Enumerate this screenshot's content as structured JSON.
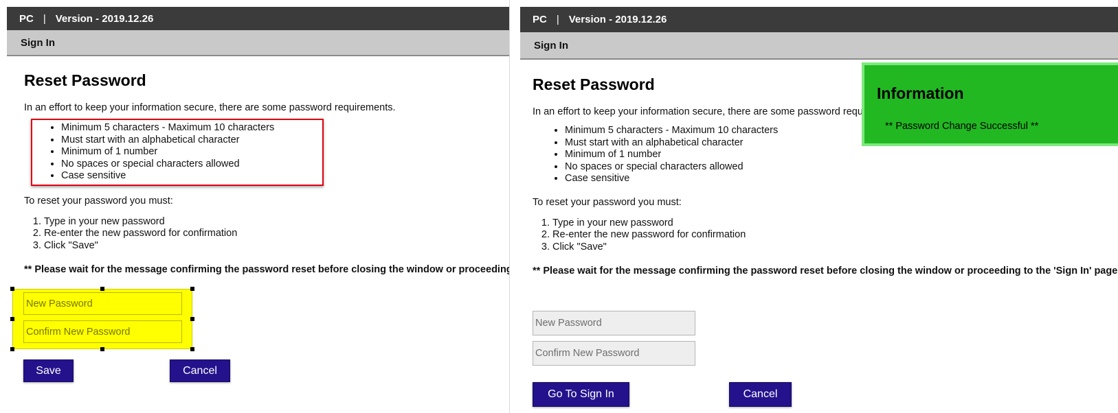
{
  "window": {
    "app": "PC",
    "separator": "|",
    "version": "Version - 2019.12.26",
    "nav": "Sign In"
  },
  "page": {
    "heading": "Reset Password",
    "intro": "In an effort to keep your information secure, there are some password requirements.",
    "requirements": [
      "Minimum 5 characters - Maximum 10 characters",
      "Must start with an alphabetical character",
      "Minimum of 1 number",
      "No spaces or special characters allowed",
      "Case sensitive"
    ],
    "steps_intro": "To reset your password you must:",
    "steps": [
      "Type in your new password",
      "Re-enter the new password for confirmation",
      "Click \"Save\""
    ],
    "warning": "** Please wait for the message confirming the password reset before closing the window or proceeding to the 'Sign In' page **",
    "new_password_placeholder": "New Password",
    "confirm_password_placeholder": "Confirm New Password"
  },
  "left_panel": {
    "save_label": "Save",
    "cancel_label": "Cancel"
  },
  "right_panel": {
    "goto_signin_label": "Go To Sign In",
    "cancel_label": "Cancel",
    "info_title": "Information",
    "info_message": "** Password Change Successful **"
  },
  "colors": {
    "titlebar": "#3b3b3b",
    "navbar": "#c9c9c9",
    "button": "#24128c",
    "highlight": "#ffff00",
    "requirement_box_border": "#e0000e",
    "info_background": "#22b822"
  }
}
